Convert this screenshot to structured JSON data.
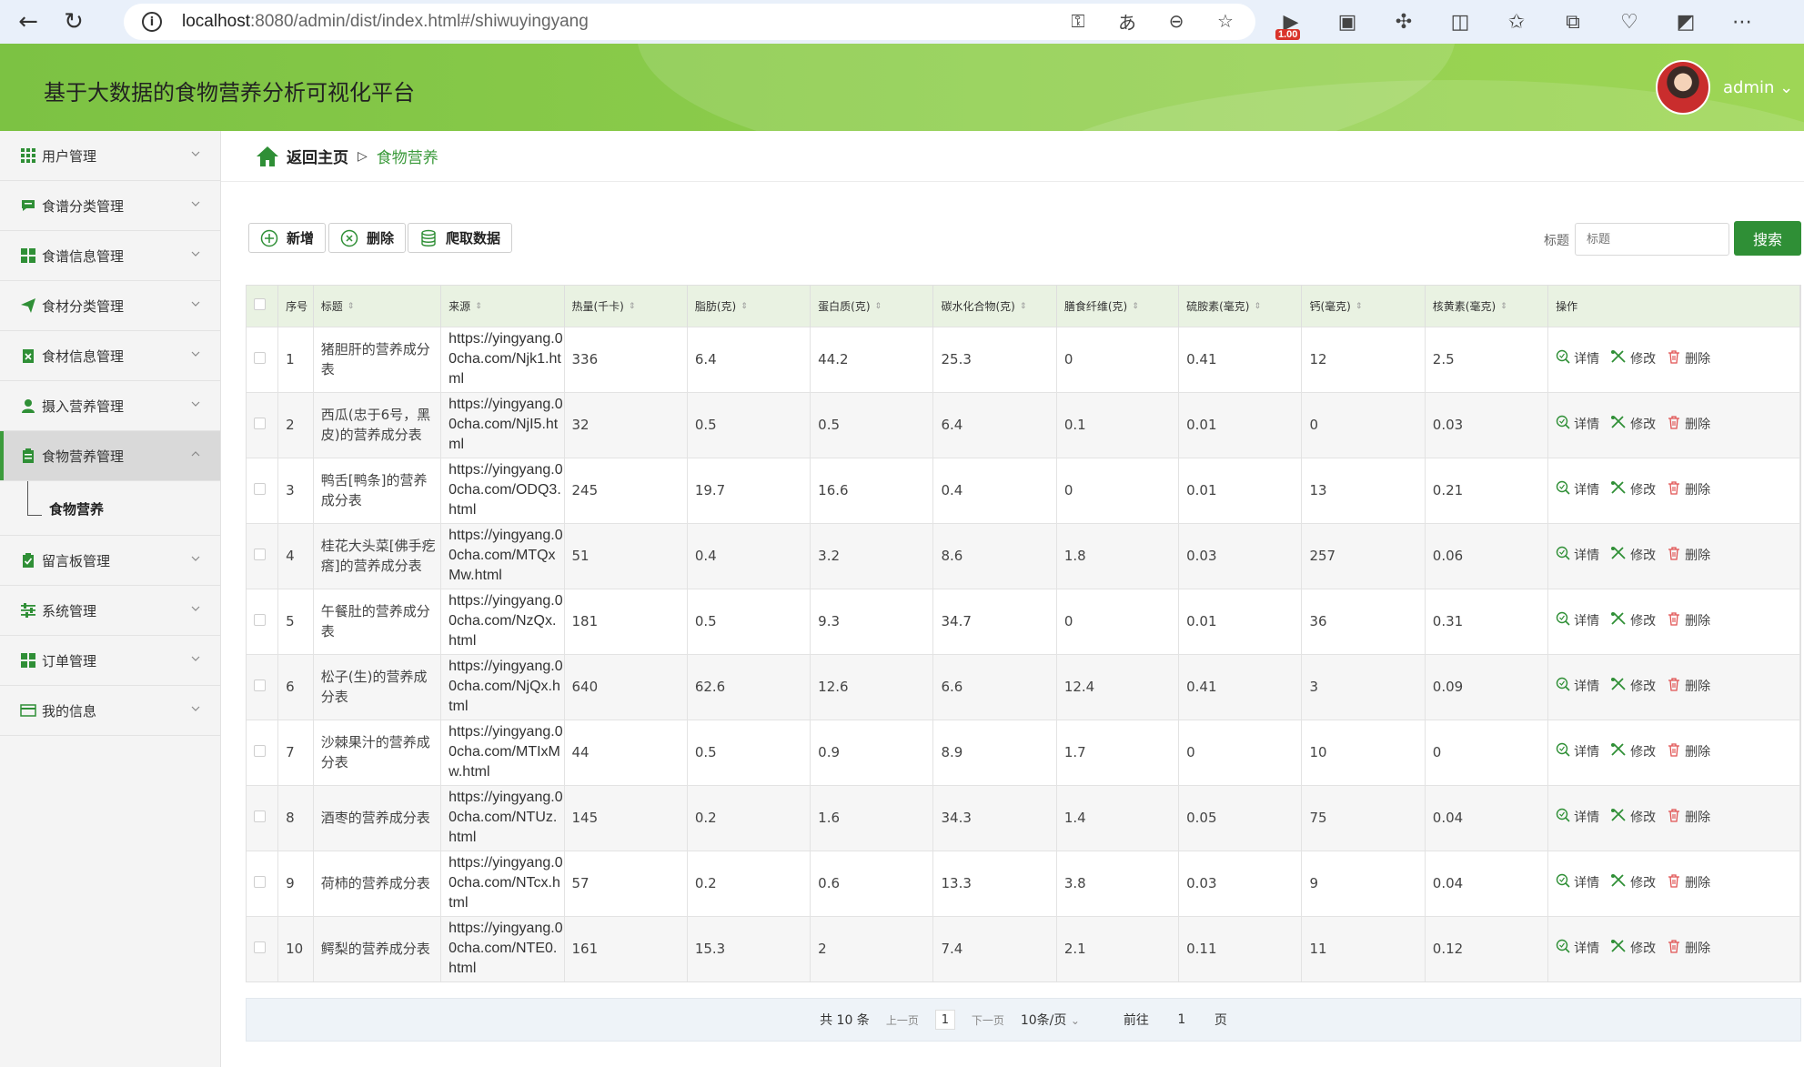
{
  "browser": {
    "url_host": "localhost",
    "url_rest": ":8080/admin/dist/index.html#/shiwuyingyang",
    "ext_badge": "1.00"
  },
  "header": {
    "title": "基于大数据的食物营养分析可视化平台",
    "user": "admin ⌄"
  },
  "sidebar": {
    "items": [
      {
        "label": "用户管理",
        "icon": "grid-icon"
      },
      {
        "label": "食谱分类管理",
        "icon": "chat-icon"
      },
      {
        "label": "食谱信息管理",
        "icon": "grid-icon"
      },
      {
        "label": "食材分类管理",
        "icon": "send-icon"
      },
      {
        "label": "食材信息管理",
        "icon": "clipboard-x-icon"
      },
      {
        "label": "摄入营养管理",
        "icon": "user-icon"
      },
      {
        "label": "食物营养管理",
        "icon": "clipboard-icon"
      },
      {
        "label": "留言板管理",
        "icon": "clipboard-check-icon"
      },
      {
        "label": "系统管理",
        "icon": "sliders-icon"
      },
      {
        "label": "订单管理",
        "icon": "grid-icon"
      },
      {
        "label": "我的信息",
        "icon": "card-icon"
      }
    ],
    "submenu_label": "食物营养"
  },
  "breadcrumb": {
    "home": "返回主页",
    "sep": "▷",
    "current": "食物营养"
  },
  "toolbar": {
    "add_label": "新增",
    "delete_label": "删除",
    "crawl_label": "爬取数据",
    "search_label": "标题",
    "search_placeholder": "标题",
    "search_button": "搜索"
  },
  "table": {
    "headers": [
      "序号",
      "标题",
      "来源",
      "热量(千卡)",
      "脂肪(克)",
      "蛋白质(克)",
      "碳水化合物(克)",
      "膳食纤维(克)",
      "硫胺素(毫克)",
      "钙(毫克)",
      "核黄素(毫克)",
      "操作"
    ],
    "actions": {
      "detail": "详情",
      "edit": "修改",
      "delete": "删除"
    },
    "rows": [
      [
        "1",
        "猪胆肝的营养成分表",
        "https://yingyang.00cha.com/Njk1.html",
        "336",
        "6.4",
        "44.2",
        "25.3",
        "0",
        "0.41",
        "12",
        "2.5"
      ],
      [
        "2",
        "西瓜(忠于6号，黑皮)的营养成分表",
        "https://yingyang.00cha.com/NjI5.html",
        "32",
        "0.5",
        "0.5",
        "6.4",
        "0.1",
        "0.01",
        "0",
        "0.03"
      ],
      [
        "3",
        "鸭舌[鸭条]的营养成分表",
        "https://yingyang.00cha.com/ODQ3.html",
        "245",
        "19.7",
        "16.6",
        "0.4",
        "0",
        "0.01",
        "13",
        "0.21"
      ],
      [
        "4",
        "桂花大头菜[佛手疙瘩]的营养成分表",
        "https://yingyang.00cha.com/MTQxMw.html",
        "51",
        "0.4",
        "3.2",
        "8.6",
        "1.8",
        "0.03",
        "257",
        "0.06"
      ],
      [
        "5",
        "午餐肚的营养成分表",
        "https://yingyang.00cha.com/NzQx.html",
        "181",
        "0.5",
        "9.3",
        "34.7",
        "0",
        "0.01",
        "36",
        "0.31"
      ],
      [
        "6",
        "松子(生)的营养成分表",
        "https://yingyang.00cha.com/NjQx.html",
        "640",
        "62.6",
        "12.6",
        "6.6",
        "12.4",
        "0.41",
        "3",
        "0.09"
      ],
      [
        "7",
        "沙棘果汁的营养成分表",
        "https://yingyang.00cha.com/MTIxMw.html",
        "44",
        "0.5",
        "0.9",
        "8.9",
        "1.7",
        "0",
        "10",
        "0"
      ],
      [
        "8",
        "酒枣的营养成分表",
        "https://yingyang.00cha.com/NTUz.html",
        "145",
        "0.2",
        "1.6",
        "34.3",
        "1.4",
        "0.05",
        "75",
        "0.04"
      ],
      [
        "9",
        "荷柿的营养成分表",
        "https://yingyang.00cha.com/NTcx.html",
        "57",
        "0.2",
        "0.6",
        "13.3",
        "3.8",
        "0.03",
        "9",
        "0.04"
      ],
      [
        "10",
        "鳄梨的营养成分表",
        "https://yingyang.00cha.com/NTE0.html",
        "161",
        "15.3",
        "2",
        "7.4",
        "2.1",
        "0.11",
        "11",
        "0.12"
      ]
    ]
  },
  "pager": {
    "total": "共 10 条",
    "prev": "上一页",
    "page": "1",
    "next": "下一页",
    "size": "10条/页",
    "goto_label": "前往",
    "goto_value": "1",
    "goto_unit": "页"
  },
  "colors": {
    "header_green": "#8fce4d",
    "accent_green": "#2f8f36",
    "table_header": "#e9f2e2"
  }
}
